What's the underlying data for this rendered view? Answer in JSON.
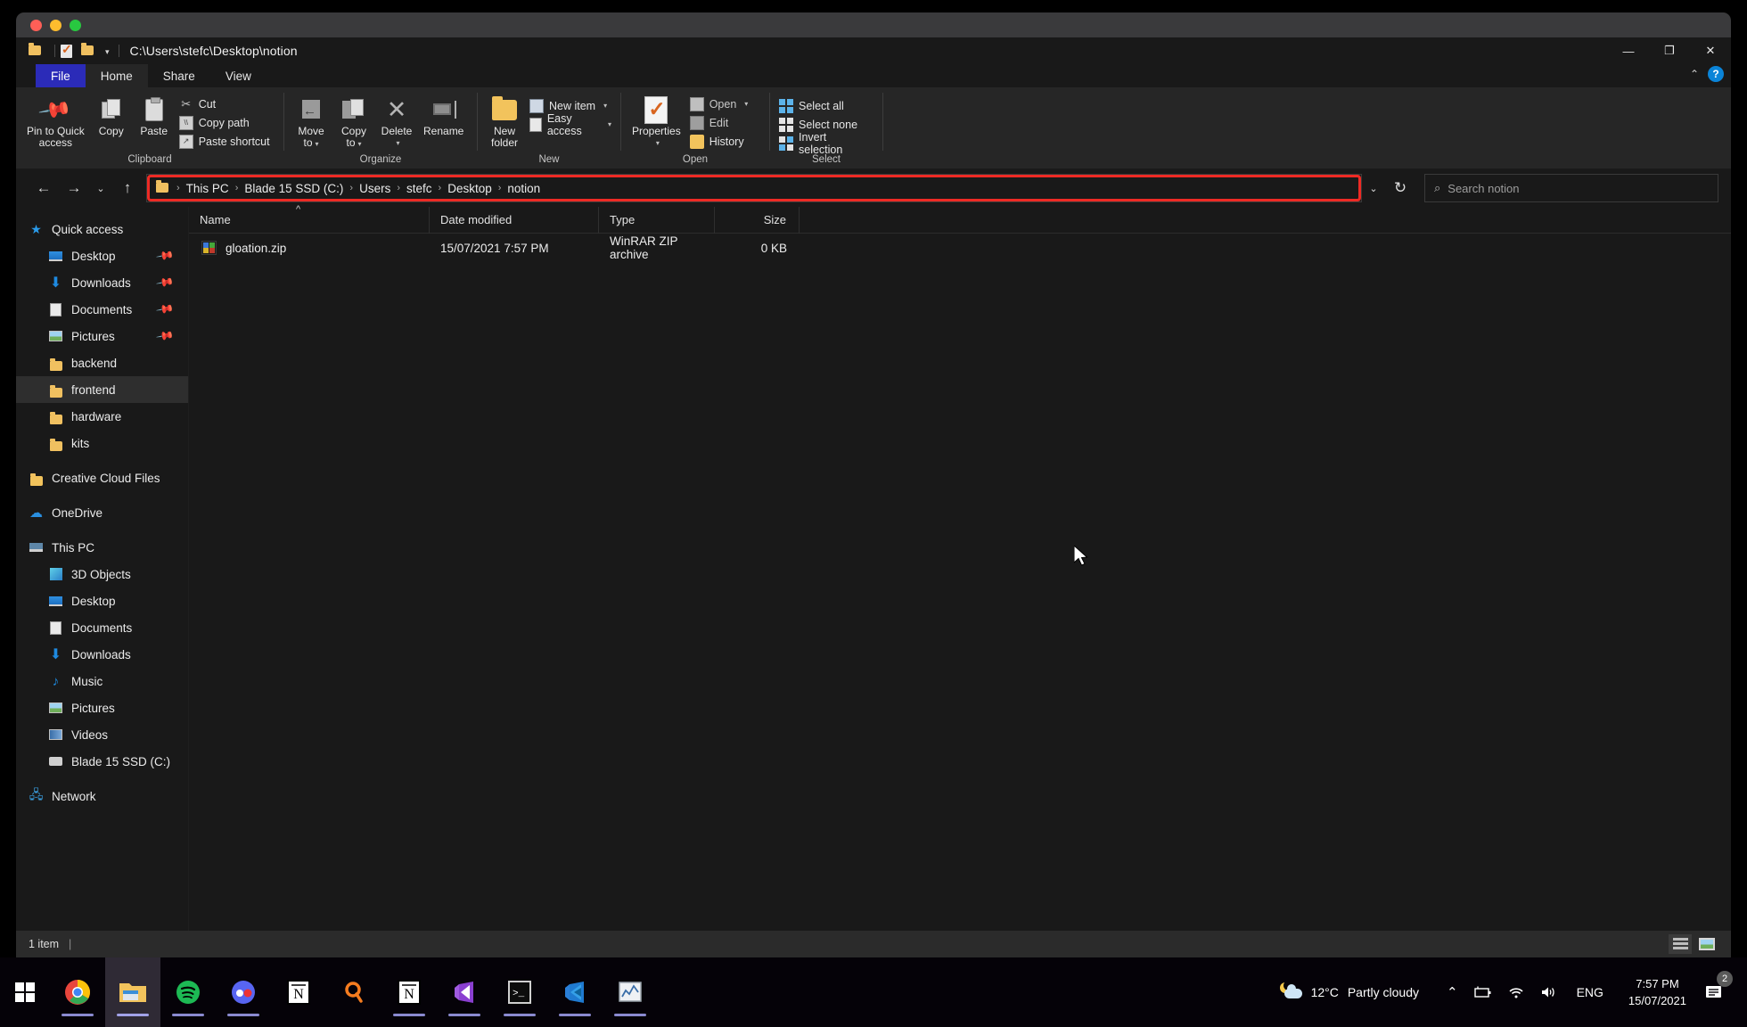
{
  "window": {
    "path_title": "C:\\Users\\stefc\\Desktop\\notion",
    "minimize_label": "—",
    "maximize_label": "❐",
    "close_label": "✕",
    "collapse_ribbon_label": "⌃",
    "help_label": "?"
  },
  "quick_access_toolbar": {
    "folder_icon": "folder-icon",
    "properties_icon": "properties-icon",
    "new_folder_icon": "new-folder-icon",
    "customize_caret": "▾"
  },
  "tabs": [
    {
      "label": "File",
      "id": "file"
    },
    {
      "label": "Home",
      "id": "home"
    },
    {
      "label": "Share",
      "id": "share"
    },
    {
      "label": "View",
      "id": "view"
    }
  ],
  "ribbon": {
    "groups": [
      {
        "label": "Clipboard",
        "big_buttons": [
          {
            "label": "Pin to Quick\naccess",
            "line1": "Pin to Quick",
            "line2": "access",
            "icon": "pin-icon"
          },
          {
            "label": "Copy",
            "line1": "Copy",
            "line2": "",
            "icon": "copy-icon"
          },
          {
            "label": "Paste",
            "line1": "Paste",
            "line2": "",
            "icon": "paste-icon"
          }
        ],
        "small_buttons": [
          {
            "label": "Cut",
            "icon": "scissors-icon"
          },
          {
            "label": "Copy path",
            "icon": "copy-path-icon"
          },
          {
            "label": "Paste shortcut",
            "icon": "paste-shortcut-icon"
          }
        ]
      },
      {
        "label": "Organize",
        "big_buttons": [
          {
            "line1": "Move",
            "line2": "to",
            "icon": "move-to-icon",
            "dropdown": true
          },
          {
            "line1": "Copy",
            "line2": "to",
            "icon": "copy-to-icon",
            "dropdown": true
          },
          {
            "line1": "Delete",
            "line2": "",
            "icon": "delete-icon",
            "dropdown": true
          },
          {
            "line1": "Rename",
            "line2": "",
            "icon": "rename-icon",
            "dropdown": false
          }
        ],
        "small_buttons": []
      },
      {
        "label": "New",
        "big_buttons": [
          {
            "line1": "New",
            "line2": "folder",
            "icon": "new-folder-icon",
            "dropdown": false
          }
        ],
        "small_buttons": [
          {
            "label": "New item",
            "icon": "new-item-icon",
            "dropdown": true
          },
          {
            "label": "Easy access",
            "icon": "easy-access-icon",
            "dropdown": true
          }
        ]
      },
      {
        "label": "Open",
        "big_buttons": [
          {
            "line1": "Properties",
            "line2": "",
            "icon": "properties-icon",
            "dropdown": true
          }
        ],
        "small_buttons": [
          {
            "label": "Open",
            "icon": "open-icon",
            "dropdown": true
          },
          {
            "label": "Edit",
            "icon": "edit-icon"
          },
          {
            "label": "History",
            "icon": "history-icon"
          }
        ]
      },
      {
        "label": "Select",
        "big_buttons": [],
        "small_buttons": [
          {
            "label": "Select all",
            "icon": "select-all-icon"
          },
          {
            "label": "Select none",
            "icon": "select-none-icon"
          },
          {
            "label": "Invert selection",
            "icon": "invert-selection-icon"
          }
        ]
      }
    ]
  },
  "address_bar": {
    "back_label": "←",
    "forward_label": "→",
    "recent_label": "⌄",
    "up_label": "↑",
    "folder_icon": "folder-icon",
    "breadcrumbs": [
      "This PC",
      "Blade 15 SSD (C:)",
      "Users",
      "stefc",
      "Desktop",
      "notion"
    ],
    "separator": "›",
    "dropdown_label": "⌄",
    "refresh_label": "↻",
    "highlight_color": "#ee2a24"
  },
  "search": {
    "icon": "search-icon",
    "placeholder": "Search notion"
  },
  "nav_pane": {
    "items": [
      {
        "label": "Quick access",
        "icon": "star-icon",
        "level": 0,
        "pinned": false,
        "selected": false
      },
      {
        "label": "Desktop",
        "icon": "desktop-icon",
        "level": 1,
        "pinned": true,
        "selected": false
      },
      {
        "label": "Downloads",
        "icon": "downloads-icon",
        "level": 1,
        "pinned": true,
        "selected": false
      },
      {
        "label": "Documents",
        "icon": "documents-icon",
        "level": 1,
        "pinned": true,
        "selected": false
      },
      {
        "label": "Pictures",
        "icon": "pictures-icon",
        "level": 1,
        "pinned": true,
        "selected": false
      },
      {
        "label": "backend",
        "icon": "folder-icon",
        "level": 1,
        "pinned": false,
        "selected": false
      },
      {
        "label": "frontend",
        "icon": "folder-icon",
        "level": 1,
        "pinned": false,
        "selected": true
      },
      {
        "label": "hardware",
        "icon": "folder-icon",
        "level": 1,
        "pinned": false,
        "selected": false
      },
      {
        "label": "kits",
        "icon": "folder-icon",
        "level": 1,
        "pinned": false,
        "selected": false
      },
      {
        "gap": true
      },
      {
        "label": "Creative Cloud Files",
        "icon": "creative-cloud-icon",
        "level": 0,
        "pinned": false,
        "selected": false
      },
      {
        "gap": true
      },
      {
        "label": "OneDrive",
        "icon": "onedrive-icon",
        "level": 0,
        "pinned": false,
        "selected": false
      },
      {
        "gap": true
      },
      {
        "label": "This PC",
        "icon": "this-pc-icon",
        "level": 0,
        "pinned": false,
        "selected": false
      },
      {
        "label": "3D Objects",
        "icon": "3d-objects-icon",
        "level": 1,
        "pinned": false,
        "selected": false
      },
      {
        "label": "Desktop",
        "icon": "desktop-icon",
        "level": 1,
        "pinned": false,
        "selected": false
      },
      {
        "label": "Documents",
        "icon": "documents-icon",
        "level": 1,
        "pinned": false,
        "selected": false
      },
      {
        "label": "Downloads",
        "icon": "downloads-icon",
        "level": 1,
        "pinned": false,
        "selected": false
      },
      {
        "label": "Music",
        "icon": "music-icon",
        "level": 1,
        "pinned": false,
        "selected": false
      },
      {
        "label": "Pictures",
        "icon": "pictures-icon",
        "level": 1,
        "pinned": false,
        "selected": false
      },
      {
        "label": "Videos",
        "icon": "videos-icon",
        "level": 1,
        "pinned": false,
        "selected": false
      },
      {
        "label": "Blade 15 SSD (C:)",
        "icon": "drive-icon",
        "level": 1,
        "pinned": false,
        "selected": false
      },
      {
        "gap": true
      },
      {
        "label": "Network",
        "icon": "network-icon",
        "level": 0,
        "pinned": false,
        "selected": false
      }
    ]
  },
  "file_list": {
    "columns": [
      "Name",
      "Date modified",
      "Type",
      "Size"
    ],
    "sort_indicator": "^",
    "rows": [
      {
        "name": "gloation.zip",
        "date_modified": "15/07/2021 7:57 PM",
        "type": "WinRAR ZIP archive",
        "size": "0 KB",
        "icon": "winrar-zip-icon"
      }
    ]
  },
  "status_bar": {
    "item_count": "1 item",
    "divider": "|",
    "view_details_icon": "details-view-icon",
    "view_large_icons_icon": "large-icons-view-icon"
  },
  "taskbar": {
    "start_label": "start-button",
    "apps": [
      {
        "name": "chrome",
        "running": true,
        "active": false
      },
      {
        "name": "file-explorer",
        "running": true,
        "active": true
      },
      {
        "name": "spotify",
        "running": true,
        "active": false
      },
      {
        "name": "discord",
        "running": true,
        "active": false
      },
      {
        "name": "notion",
        "running": false,
        "active": false
      },
      {
        "name": "search",
        "running": false,
        "active": false
      },
      {
        "name": "notion-alt",
        "running": true,
        "active": false
      },
      {
        "name": "visual-studio",
        "running": true,
        "active": false
      },
      {
        "name": "terminal",
        "running": true,
        "active": false
      },
      {
        "name": "vs-code",
        "running": true,
        "active": false
      },
      {
        "name": "task-manager",
        "running": true,
        "active": false
      }
    ],
    "tray": {
      "weather_temp": "12°C",
      "weather_desc": "Partly cloudy",
      "show_hidden_label": "⌃",
      "battery_icon": "battery-icon",
      "wifi_icon": "wifi-icon",
      "volume_icon": "volume-icon",
      "language": "ENG",
      "time": "7:57 PM",
      "date": "15/07/2021",
      "notification_count": "2"
    }
  }
}
